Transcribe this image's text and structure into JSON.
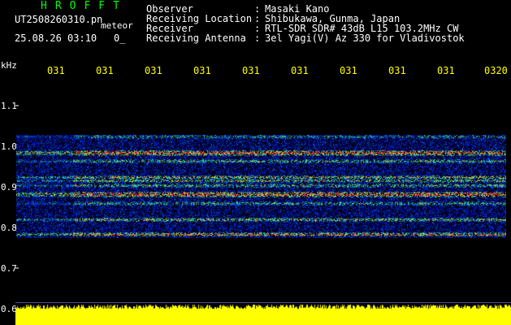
{
  "header": {
    "title": "HROFFT",
    "filename": "UT2508260310.pn",
    "ext": "meteor",
    "datetime": "25.08.26 03:10",
    "extra": "0_",
    "rows": [
      {
        "label": "Observer",
        "value": "Masaki Kano"
      },
      {
        "label": "Receiving Location",
        "value": "Shibukawa, Gunma, Japan"
      },
      {
        "label": "Receiver",
        "value": "RTL-SDR SDR# 43dB L15 103.2MHz CW"
      },
      {
        "label": "Receiving Antenna",
        "value": "3el Yagi(V) Az 330 for Vladivostok"
      }
    ],
    "separator": ":"
  },
  "axis": {
    "unit": "kHz",
    "time_ticks": [
      "031",
      "031",
      "031",
      "031",
      "031",
      "031",
      "031",
      "031",
      "031",
      "0320"
    ],
    "freq_ticks": [
      "1.1",
      "1.0",
      "0.9",
      "0.8",
      "0.7",
      "0.6"
    ]
  },
  "colors": {
    "background": "#000000",
    "text": "#ffffff",
    "tick": "#ffff00",
    "title": "#00ff00",
    "noise_floor": "#ffff00"
  }
}
